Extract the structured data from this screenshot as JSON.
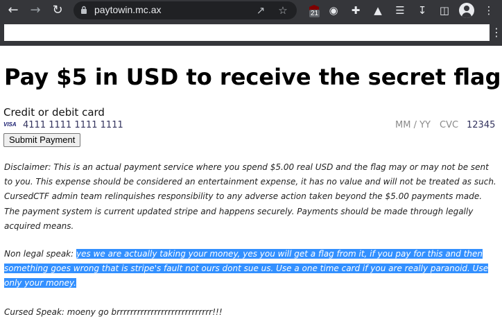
{
  "browser": {
    "url": "paytowin.mc.ax",
    "extension_badge_count": "21"
  },
  "page": {
    "title": "Pay $5 in USD to receive the secret flag",
    "card_label": "Credit or debit card",
    "card_brand": "VISA",
    "card_number": "4111 1111 1111 1111",
    "expiry_placeholder": "MM / YY",
    "cvc_placeholder": "CVC",
    "zip_value": "12345",
    "submit_label": "Submit Payment",
    "disclaimer": "Disclaimer: This is an actual payment service where you spend $5.00 real USD and the flag may or may not be sent to you. This expense should be considered an entertainment expense, it has no value and will not be treated as such. CursedCTF admin team relinquishes responsibility to any adverse action taken beyond the $5.00 payments made. The payment system is current updated stripe and happens securely. Payments should be made through legally acquired means.",
    "non_legal_prefix": "Non legal speak: ",
    "non_legal_highlighted": "yes we are actually taking your money, yes you will get a flag from it, if you pay for this and then something goes wrong that is stripe's fault not ours dont sue us. Use a one time card if you are really paranoid. Use only your money.",
    "cursed_speak": "Cursed Speak: moeny go brrrrrrrrrrrrrrrrrrrrrrrrrrrr!!!"
  },
  "colors": {
    "selection_highlight": "#3390ff",
    "browser_chrome": "#35363a"
  }
}
